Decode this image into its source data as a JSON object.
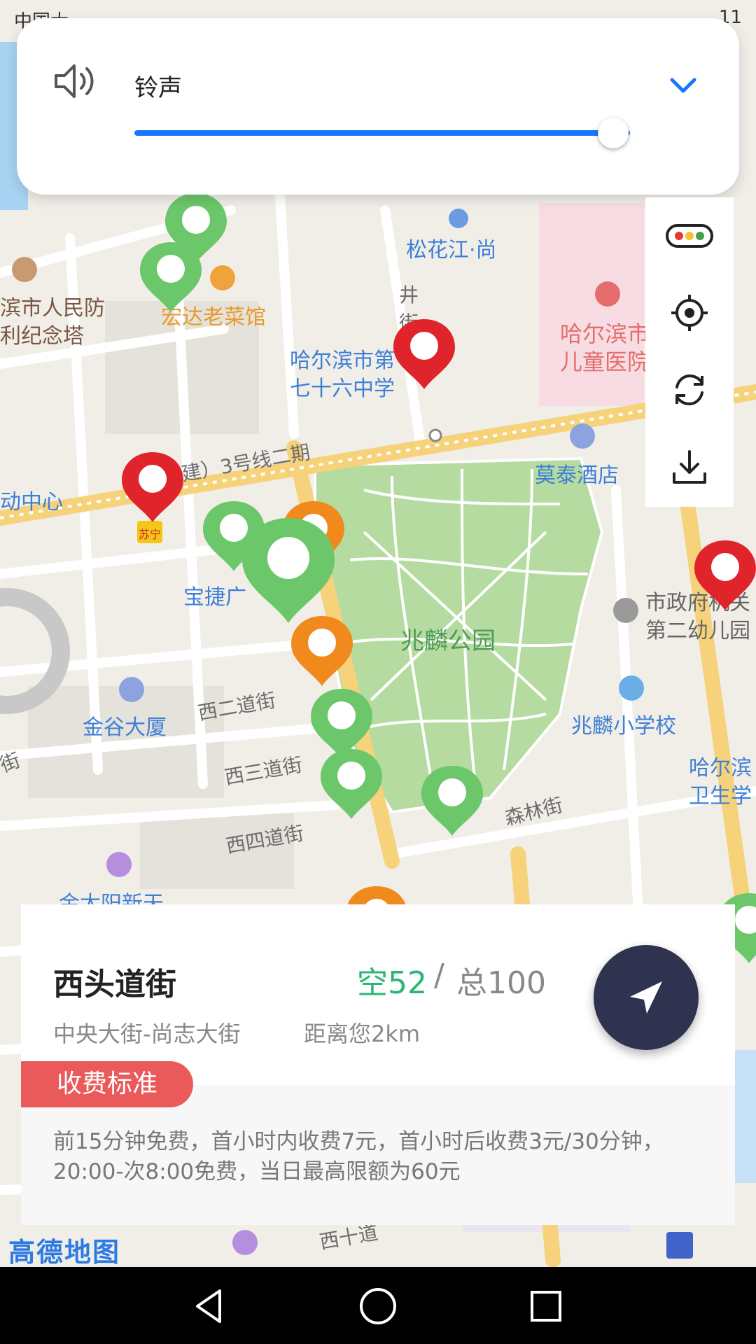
{
  "status_bar": {
    "left_text": "中国大",
    "right_text": "11"
  },
  "volume_popup": {
    "label": "铃声",
    "level_percent": 100,
    "icons": {
      "speaker": "speaker-icon",
      "expand": "chevron-down-icon"
    }
  },
  "map": {
    "labels": {
      "songhuajiang": "松花江·尚",
      "renmin_1": "滨市人民防",
      "renmin_2": "利纪念塔",
      "hongda": "宏达老菜馆",
      "school76_1": "哈尔滨市第",
      "school76_2": "七十六中学",
      "hospital_1": "哈尔滨市",
      "hospital_2": "儿童医院",
      "jing_street": "井街",
      "metro": "建）3号线二期",
      "center": "动中心",
      "motai": "莫泰酒店",
      "baojie": "宝捷广",
      "park": "兆麟公园",
      "kinder_1": "市政府机关",
      "kinder_2": "第二幼儿园",
      "jingu": "金谷大厦",
      "xier": "西二道街",
      "xisan": "西三道街",
      "xisi": "西四道街",
      "zhaolin_school": "兆麟小学校",
      "health_1": "哈尔滨",
      "health_2": "卫生学",
      "senlin": "森林街",
      "jintaiyang": "金太阳新天",
      "suning": "苏宁",
      "street_left": "街",
      "xiqi": "西十道"
    },
    "logo": "高德地图"
  },
  "tools": [
    "traffic-icon",
    "locate-icon",
    "refresh-icon",
    "download-icon"
  ],
  "card": {
    "title": "西头道街",
    "free_label": "空52",
    "separator": "/",
    "total_label": "总100",
    "route": "中央大街-尚志大街",
    "distance": "距离您2km",
    "fee_badge": "收费标准",
    "fee_text": "前15分钟免费，首小时内收费7元，首小时后收费3元/30分钟，20:00-次8:00免费，当日最高限额为60元"
  },
  "colors": {
    "accent_blue": "#1677ff",
    "free_green": "#2bb673",
    "fee_red": "#ea5a5a",
    "nav_dark": "#2f3350"
  }
}
